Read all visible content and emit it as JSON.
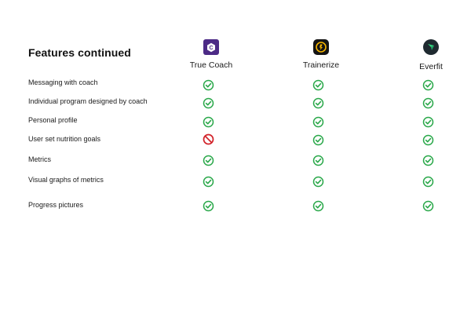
{
  "title": "Features continued",
  "apps": [
    {
      "name": "True Coach",
      "logo_icon": "truecoach-logo-icon"
    },
    {
      "name": "Trainerize",
      "logo_icon": "trainerize-logo-icon"
    },
    {
      "name": "Everfit",
      "logo_icon": "everfit-logo-icon"
    }
  ],
  "colors": {
    "check": "#2aa84a",
    "unavailable": "#d2232a"
  },
  "features": [
    {
      "label": "Messaging with coach",
      "support": [
        "check",
        "check",
        "check"
      ]
    },
    {
      "label": "Individual program designed by coach",
      "support": [
        "check",
        "check",
        "check"
      ]
    },
    {
      "label": "Personal profile",
      "support": [
        "check",
        "check",
        "check"
      ]
    },
    {
      "label": "User set nutrition goals",
      "support": [
        "unavailable",
        "check",
        "check"
      ]
    },
    {
      "label": "Metrics",
      "support": [
        "check",
        "check",
        "check"
      ]
    },
    {
      "label": "Visual graphs of metrics",
      "support": [
        "check",
        "check",
        "check"
      ]
    },
    {
      "label": "Progress pictures",
      "support": [
        "check",
        "check",
        "check"
      ]
    }
  ]
}
